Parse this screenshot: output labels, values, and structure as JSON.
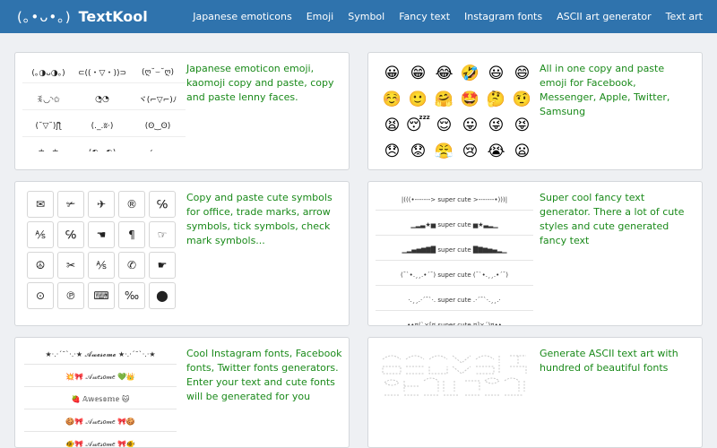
{
  "brand": {
    "face": "(｡•ᴗ•｡)",
    "name": "TextKool"
  },
  "nav": [
    "Japanese emoticons",
    "Emoji",
    "Symbol",
    "Fancy text",
    "Instagram fonts",
    "ASCII art generator",
    "Text art"
  ],
  "cards": {
    "japanese": {
      "text": "Japanese emoticon emoji, kaomoji copy and paste, copy and paste lenny faces.",
      "items": [
        "(｡◑ᴗ◑｡)",
        "⊂((・▽・))⊃",
        "(ღ˘⌣˘ღ)",
        "ꉂ◡◝✩",
        "◔̯◔",
        "ヾ(⌐▽⌐)ﾉ",
        "(˘▽˘)ʃƪ",
        "(._.ʬ·)",
        "(ʘ‿ʘ)",
        "ф◡ф",
        "(◐◡◐)",
        "(･ᴗ･"
      ]
    },
    "emoji": {
      "text": "All in one copy and paste emoji for Facebook, Messenger, Apple, Twitter, Samsung",
      "items": [
        "😀",
        "😁",
        "😂",
        "🤣",
        "😃",
        "😄",
        "☺️",
        "🙂",
        "🤗",
        "🤩",
        "🤔",
        "🤨",
        "😫",
        "😴",
        "😌",
        "😛",
        "😜",
        "😝",
        "😞",
        "😟",
        "😤",
        "😢",
        "😭",
        "😦"
      ]
    },
    "symbol": {
      "text": "Copy and paste cute symbols for office, trade marks, arrow symbols, tick symbols, check mark symbols...",
      "items": [
        "✉",
        "✃",
        "✈",
        "®",
        "℅",
        "⅍",
        "℅",
        "☚",
        "¶",
        "☞",
        "☮",
        "✂",
        "⅍",
        "✆",
        "☛",
        "⊙",
        "℗",
        "⌨",
        "‰",
        "⬤"
      ]
    },
    "fancy": {
      "text": "Super cool fancy text generator. There a lot of cute styles and cute generated fancy text",
      "items": [
        "|(((•-------> super cute >-------•)))|",
        "▁▂▃★▅ super cute ▅★▃▂▁",
        "▁▂▄▅▆▇█ super cute █▇▆▅▄▂▁",
        "(¯`•.¸¸.•´¯) super cute (¯`•.¸¸.•´¯)",
        "·.¸¸.·´¯`·. super cute .·´¯`·.¸¸.·",
        "••¤(`×[¤ super cute ¤]×´)¤••"
      ]
    },
    "instagram": {
      "text": "Cool Instagram fonts, Facebook fonts, Twitter fonts generators. Enter your text and cute fonts will be generated for you",
      "items": [
        "★·.·´¯`·.·★ 𝓐𝔀𝓮𝓼𝓸𝓶𝓮 ★·.·´¯`·.·★",
        "💥🎀 𝒜𝓌𝑒𝓈𝑜𝓂𝑒 💚👑",
        "🍓 𝔸𝕨𝕖𝕤𝕠𝕞𝕖 🐱",
        "🍪🎀 𝒜𝓌𝑒𝓈𝑜𝓂𝑒 🎀🍪",
        "🐠🎀 𝒜𝓌𝑒𝓈𝑜𝓂𝑒 🎀🐠"
      ]
    },
    "ascii": {
      "text": "Generate ASCII text art with hundred of beautiful fonts"
    }
  },
  "colors": {
    "nav": "#2f73ad",
    "accent_text": "#1a8a1a"
  }
}
